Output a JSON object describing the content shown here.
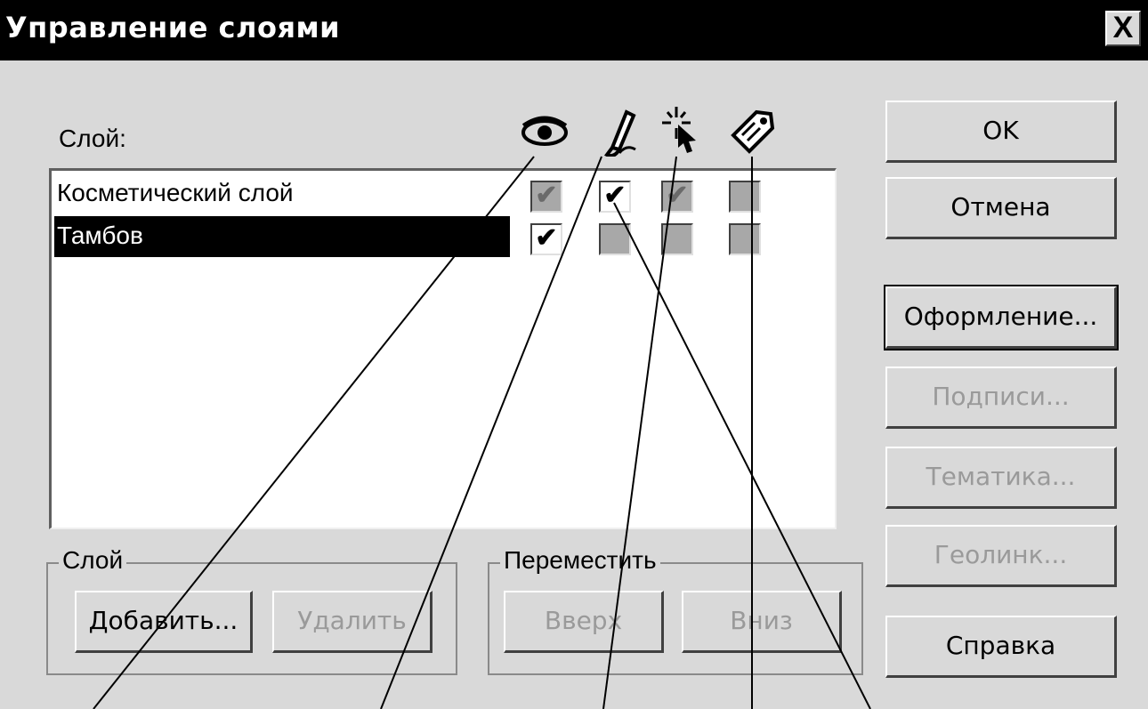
{
  "window": {
    "title": "Управление слоями",
    "close_label": "X"
  },
  "layer_list": {
    "label": "Слой:",
    "column_icons": [
      "eye-icon",
      "pencil-icon",
      "cursor-icon",
      "tag-icon"
    ],
    "rows": [
      {
        "name": "Косметический слой",
        "selected": false,
        "checks": [
          "✔",
          "✔",
          "✔",
          ""
        ],
        "disabled": [
          true,
          false,
          true,
          true
        ]
      },
      {
        "name": "Тамбов",
        "selected": true,
        "checks": [
          "✔",
          "",
          "",
          ""
        ],
        "disabled": [
          false,
          true,
          true,
          true
        ]
      }
    ]
  },
  "buttons": {
    "ok": "OK",
    "cancel": "Отмена",
    "style": "Оформление...",
    "labels": "Подписи...",
    "thematic": "Тематика...",
    "geolink": "Геолинк...",
    "help": "Справка"
  },
  "layer_group": {
    "title": "Слой",
    "add": "Добавить...",
    "remove": "Удалить"
  },
  "move_group": {
    "title": "Переместить",
    "up": "Вверх",
    "down": "Вниз"
  }
}
